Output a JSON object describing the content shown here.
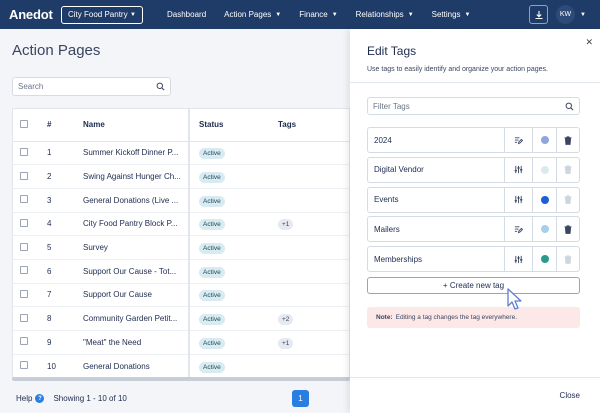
{
  "nav": {
    "logo": "Anedot",
    "org": "City Food Pantry",
    "items": [
      {
        "label": "Dashboard",
        "caret": false
      },
      {
        "label": "Action Pages",
        "caret": true
      },
      {
        "label": "Finance",
        "caret": true
      },
      {
        "label": "Relationships",
        "caret": true
      },
      {
        "label": "Settings",
        "caret": true
      }
    ],
    "user_initials": "KW"
  },
  "page": {
    "title": "Action Pages",
    "search_placeholder": "Search"
  },
  "table": {
    "columns": [
      "#",
      "Name",
      "Status",
      "Tags"
    ],
    "rows": [
      {
        "num": "1",
        "name": "Summer Kickoff Dinner P...",
        "status": "Active",
        "tags": ""
      },
      {
        "num": "2",
        "name": "Swing Against Hunger Ch...",
        "status": "Active",
        "tags": ""
      },
      {
        "num": "3",
        "name": "General Donations (Live ...",
        "status": "Active",
        "tags": ""
      },
      {
        "num": "4",
        "name": "City Food Pantry Block P...",
        "status": "Active",
        "tags": "+1"
      },
      {
        "num": "5",
        "name": "Survey",
        "status": "Active",
        "tags": ""
      },
      {
        "num": "6",
        "name": "Support Our Cause - Tot...",
        "status": "Active",
        "tags": ""
      },
      {
        "num": "7",
        "name": "Support Our Cause",
        "status": "Active",
        "tags": ""
      },
      {
        "num": "8",
        "name": "Community Garden Petit...",
        "status": "Active",
        "tags": "+2"
      },
      {
        "num": "9",
        "name": "\"Meat\" the Need",
        "status": "Active",
        "tags": "+1"
      },
      {
        "num": "10",
        "name": "General Donations",
        "status": "Active",
        "tags": ""
      }
    ]
  },
  "footer": {
    "help": "Help",
    "showing": "Showing 1 - 10 of 10",
    "page": "1"
  },
  "drawer": {
    "title": "Edit Tags",
    "subtitle": "Use tags to easily identify and organize your action pages.",
    "filter_placeholder": "Filter Tags",
    "tags": [
      {
        "name": "2024",
        "action_icon": "edit-icon",
        "color": "#8fa6d9",
        "deletable": true
      },
      {
        "name": "Digital Vendor",
        "action_icon": "sliders-icon",
        "color": "#dce9ef",
        "deletable": false
      },
      {
        "name": "Events",
        "action_icon": "sliders-icon",
        "color": "#1a5fd6",
        "deletable": false
      },
      {
        "name": "Mailers",
        "action_icon": "edit-icon",
        "color": "#a9cfe6",
        "deletable": true
      },
      {
        "name": "Memberships",
        "action_icon": "sliders-icon",
        "color": "#2a9a8c",
        "deletable": false
      }
    ],
    "create_label": "+ Create new tag",
    "note_label": "Note:",
    "note_text": "Editing a tag changes the tag everywhere.",
    "close_label": "Close"
  }
}
